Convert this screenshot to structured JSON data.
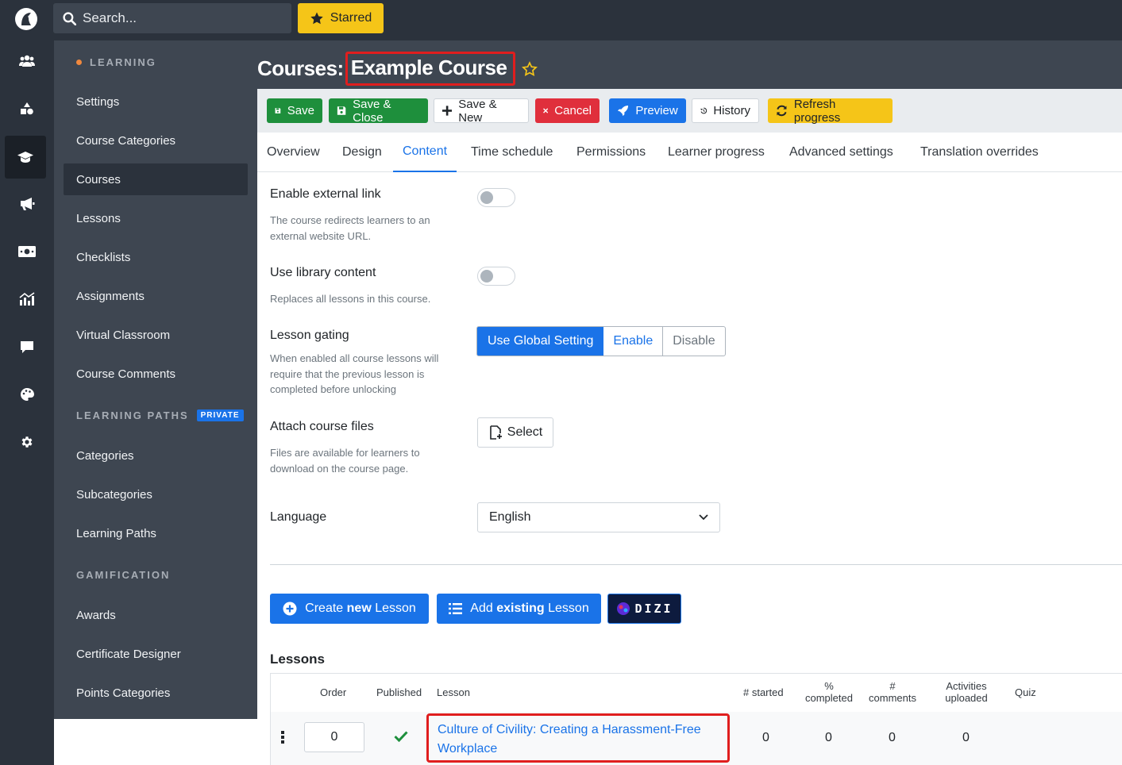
{
  "topbar": {
    "search_placeholder": "Search...",
    "starred_label": "Starred"
  },
  "sidebar": {
    "section_learning": "LEARNING",
    "items_learning": [
      "Settings",
      "Course Categories",
      "Courses",
      "Lessons",
      "Checklists",
      "Assignments",
      "Virtual Classroom",
      "Course Comments"
    ],
    "section_paths": "LEARNING PATHS",
    "private_badge": "PRIVATE",
    "items_paths": [
      "Categories",
      "Subcategories",
      "Learning Paths"
    ],
    "section_gamification": "GAMIFICATION",
    "items_gamification": [
      "Awards",
      "Certificate Designer",
      "Points Categories"
    ],
    "active_item": "Courses"
  },
  "header": {
    "title_prefix": "Courses:",
    "course_name": "Example Course"
  },
  "toolbar": {
    "save": "Save",
    "save_close": "Save & Close",
    "save_new": "Save & New",
    "cancel": "Cancel",
    "preview": "Preview",
    "history": "History",
    "refresh": "Refresh progress"
  },
  "tabs": [
    "Overview",
    "Design",
    "Content",
    "Time schedule",
    "Permissions",
    "Learner progress",
    "Advanced settings",
    "Translation overrides"
  ],
  "active_tab": "Content",
  "form": {
    "external_link_label": "Enable external link",
    "external_link_help": "The course redirects learners to an external website URL.",
    "external_link_on": false,
    "library_label": "Use library content",
    "library_help": "Replaces all lessons in this course.",
    "library_on": false,
    "gating_label": "Lesson gating",
    "gating_help": "When enabled all course lessons will require that the previous lesson is completed before unlocking",
    "gating_options": [
      "Use Global Setting",
      "Enable",
      "Disable"
    ],
    "gating_selected": "Use Global Setting",
    "files_label": "Attach course files",
    "files_help": "Files are available for learners to download on the course page.",
    "files_button": "Select",
    "language_label": "Language",
    "language_value": "English"
  },
  "lesson_actions": {
    "create_prefix": "Create ",
    "create_bold": "new",
    "create_suffix": " Lesson",
    "add_prefix": "Add ",
    "add_bold": "existing",
    "add_suffix": " Lesson",
    "dizi_label": "DIZI"
  },
  "lessons": {
    "title": "Lessons",
    "columns": [
      "Order",
      "Published",
      "Lesson",
      "# started",
      "% completed",
      "# comments",
      "Activities uploaded",
      "Quiz"
    ],
    "rows": [
      {
        "order": "0",
        "published": true,
        "lesson": "Culture of Civility: Creating a Harassment-Free Workplace",
        "started": "0",
        "completed": "0",
        "comments": "0",
        "activities": "0",
        "quiz": ""
      }
    ]
  },
  "colors": {
    "dark": "#2b323c",
    "sidebar": "#3e4651",
    "primary": "#1a73e8",
    "success": "#1e8f3c",
    "danger": "#e02f3c",
    "warning": "#f5c518",
    "highlight": "#e01e1e"
  }
}
